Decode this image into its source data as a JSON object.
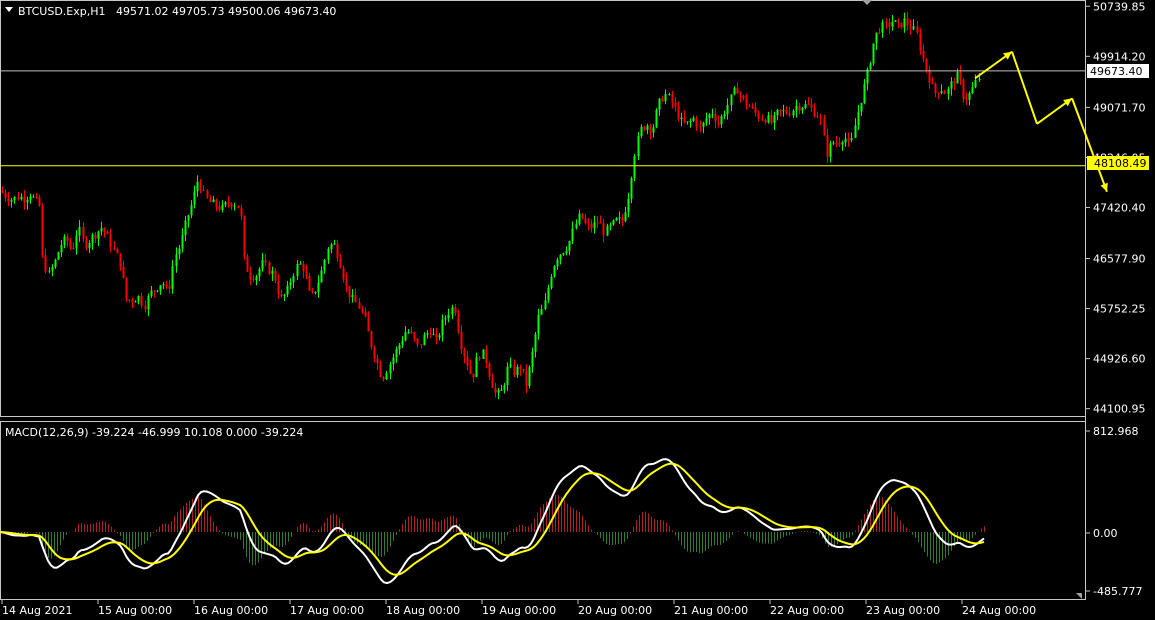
{
  "colors": {
    "background": "#000000",
    "axis": "#c8c8c8",
    "text": "#ffffff",
    "bull": "#00ff00",
    "bear": "#ff0000",
    "level_line": "#c0c0c0",
    "support_line": "#ffff00",
    "label_bg_current": "#ffffff",
    "label_bg_support": "#ffff00",
    "macd_line": "#ffffff",
    "signal_line": "#ffff00",
    "hist_pos": "#b22222",
    "hist_neg": "#2e7d32",
    "arrows": "#ffff00"
  },
  "header": {
    "symbol_timeframe": "BTCUSD.Exp,H1",
    "ohlc": "49571.02 49705.73 49500.06 49673.40",
    "menu_icon": "triangle-down-icon"
  },
  "price_axis": {
    "ticks": [
      "50739.85",
      "49914.20",
      "49071.70",
      "48246.05",
      "47420.40",
      "46577.90",
      "45752.25",
      "44926.60",
      "44100.95"
    ],
    "current_label": "49673.40",
    "support_label": "48108.49"
  },
  "indicator": {
    "label": "MACD(12,26,9) -39.224 -46.999 10.108 0.000 -39.224",
    "axis_ticks": [
      "812.968",
      "0.00",
      "-485.777"
    ]
  },
  "time_axis": {
    "labels": [
      "14 Aug 2021",
      "15 Aug 00:00",
      "16 Aug 00:00",
      "17 Aug 00:00",
      "18 Aug 00:00",
      "19 Aug 00:00",
      "20 Aug 00:00",
      "21 Aug 00:00",
      "22 Aug 00:00",
      "23 Aug 00:00",
      "24 Aug 00:00"
    ]
  },
  "chart_data": {
    "type": "candlestick",
    "y_range": [
      43980,
      50810
    ],
    "horizontal_lines": [
      49673.4,
      48108.49
    ],
    "close_path": [
      [
        0,
        47700
      ],
      [
        6,
        47600
      ],
      [
        12,
        47550
      ],
      [
        18,
        47600
      ],
      [
        24,
        47570
      ],
      [
        30,
        47650
      ],
      [
        36,
        47500
      ],
      [
        38,
        47800
      ],
      [
        42,
        46600
      ],
      [
        48,
        46300
      ],
      [
        54,
        46500
      ],
      [
        60,
        46800
      ],
      [
        66,
        46900
      ],
      [
        72,
        46700
      ],
      [
        78,
        47100
      ],
      [
        84,
        46800
      ],
      [
        90,
        46900
      ],
      [
        96,
        47000
      ],
      [
        102,
        47100
      ],
      [
        108,
        46900
      ],
      [
        114,
        46700
      ],
      [
        120,
        46500
      ],
      [
        126,
        45900
      ],
      [
        132,
        45900
      ],
      [
        138,
        45950
      ],
      [
        144,
        45800
      ],
      [
        150,
        46000
      ],
      [
        156,
        46100
      ],
      [
        162,
        46200
      ],
      [
        168,
        46000
      ],
      [
        174,
        46600
      ],
      [
        180,
        46800
      ],
      [
        186,
        47200
      ],
      [
        192,
        47500
      ],
      [
        198,
        47900
      ],
      [
        204,
        47600
      ],
      [
        210,
        47500
      ],
      [
        216,
        47450
      ],
      [
        222,
        47400
      ],
      [
        228,
        47500
      ],
      [
        234,
        47500
      ],
      [
        240,
        47400
      ],
      [
        244,
        46500
      ],
      [
        250,
        46300
      ],
      [
        256,
        46300
      ],
      [
        262,
        46500
      ],
      [
        268,
        46400
      ],
      [
        274,
        46300
      ],
      [
        280,
        45900
      ],
      [
        286,
        46000
      ],
      [
        292,
        46300
      ],
      [
        298,
        46500
      ],
      [
        304,
        46400
      ],
      [
        310,
        45900
      ],
      [
        316,
        46100
      ],
      [
        322,
        46400
      ],
      [
        328,
        46800
      ],
      [
        334,
        46800
      ],
      [
        340,
        46500
      ],
      [
        346,
        46100
      ],
      [
        352,
        45900
      ],
      [
        358,
        45800
      ],
      [
        364,
        45600
      ],
      [
        370,
        45200
      ],
      [
        376,
        44900
      ],
      [
        382,
        44600
      ],
      [
        388,
        44800
      ],
      [
        394,
        45000
      ],
      [
        400,
        45200
      ],
      [
        406,
        45400
      ],
      [
        412,
        45300
      ],
      [
        418,
        45100
      ],
      [
        424,
        45300
      ],
      [
        430,
        45400
      ],
      [
        436,
        45200
      ],
      [
        442,
        45500
      ],
      [
        448,
        45700
      ],
      [
        454,
        45800
      ],
      [
        460,
        45200
      ],
      [
        466,
        44900
      ],
      [
        472,
        44600
      ],
      [
        478,
        45000
      ],
      [
        484,
        45000
      ],
      [
        490,
        44600
      ],
      [
        496,
        44300
      ],
      [
        502,
        44400
      ],
      [
        508,
        44800
      ],
      [
        514,
        44700
      ],
      [
        520,
        44800
      ],
      [
        526,
        44500
      ],
      [
        532,
        45000
      ],
      [
        538,
        45600
      ],
      [
        544,
        45800
      ],
      [
        550,
        46300
      ],
      [
        556,
        46600
      ],
      [
        562,
        46700
      ],
      [
        568,
        46800
      ],
      [
        574,
        47100
      ],
      [
        580,
        47300
      ],
      [
        586,
        47100
      ],
      [
        592,
        47100
      ],
      [
        598,
        47200
      ],
      [
        604,
        47000
      ],
      [
        610,
        47100
      ],
      [
        616,
        47200
      ],
      [
        622,
        47200
      ],
      [
        628,
        47600
      ],
      [
        634,
        48300
      ],
      [
        640,
        48700
      ],
      [
        646,
        48800
      ],
      [
        652,
        48700
      ],
      [
        658,
        49100
      ],
      [
        664,
        49300
      ],
      [
        670,
        49200
      ],
      [
        676,
        49000
      ],
      [
        682,
        48800
      ],
      [
        688,
        48800
      ],
      [
        694,
        48900
      ],
      [
        700,
        48700
      ],
      [
        706,
        48900
      ],
      [
        712,
        49000
      ],
      [
        718,
        48800
      ],
      [
        724,
        49000
      ],
      [
        730,
        49200
      ],
      [
        736,
        49400
      ],
      [
        742,
        49200
      ],
      [
        748,
        49100
      ],
      [
        754,
        49000
      ],
      [
        760,
        48900
      ],
      [
        766,
        48900
      ],
      [
        772,
        48800
      ],
      [
        778,
        49000
      ],
      [
        784,
        49000
      ],
      [
        790,
        49000
      ],
      [
        796,
        49100
      ],
      [
        802,
        49100
      ],
      [
        808,
        49100
      ],
      [
        814,
        49000
      ],
      [
        820,
        48900
      ],
      [
        826,
        48300
      ],
      [
        832,
        48500
      ],
      [
        838,
        48500
      ],
      [
        844,
        48600
      ],
      [
        850,
        48400
      ],
      [
        856,
        48900
      ],
      [
        862,
        49300
      ],
      [
        868,
        49700
      ],
      [
        874,
        50200
      ],
      [
        880,
        50400
      ],
      [
        886,
        50400
      ],
      [
        892,
        50500
      ],
      [
        898,
        50400
      ],
      [
        904,
        50500
      ],
      [
        910,
        50400
      ],
      [
        916,
        50300
      ],
      [
        922,
        49900
      ],
      [
        928,
        49600
      ],
      [
        934,
        49300
      ],
      [
        940,
        49400
      ],
      [
        946,
        49300
      ],
      [
        952,
        49500
      ],
      [
        958,
        49600
      ],
      [
        964,
        49200
      ],
      [
        970,
        49300
      ],
      [
        976,
        49500
      ],
      [
        982,
        49650
      ]
    ],
    "arrow_projection": [
      [
        975,
        49550
      ],
      [
        1012,
        49990
      ],
      [
        1037,
        48800
      ],
      [
        1072,
        49220
      ],
      [
        1107,
        47680
      ]
    ]
  }
}
